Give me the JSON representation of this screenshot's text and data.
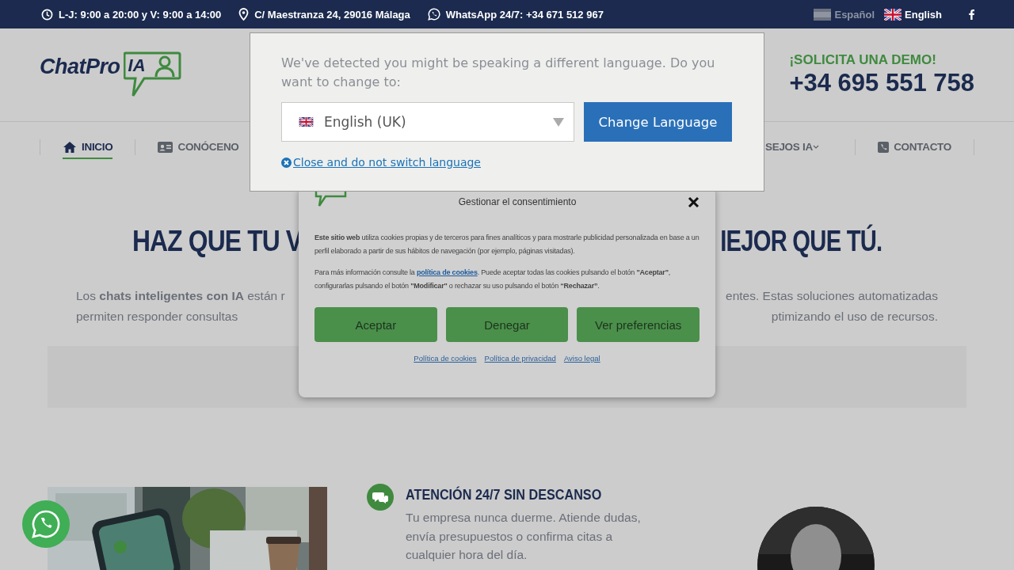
{
  "top_bar": {
    "hours": "L-J: 9:00 a 20:00 y V: 9:00 a 14:00",
    "address": "C/ Maestranza 24, 29016 Málaga",
    "whatsapp": "WhatsApp 24/7: +34 671 512 967",
    "languages": [
      {
        "label": "Español",
        "selected": false
      },
      {
        "label": "English",
        "selected": true
      }
    ]
  },
  "header": {
    "logo_text": "ChatPro",
    "logo_badge": "IA",
    "demo_label": "¡SOLICITA UNA DEMO!",
    "phone": "+34 695 551 758"
  },
  "nav": [
    {
      "label": "INICIO",
      "selected": true,
      "dropdown": false
    },
    {
      "label": "CONÓCENO",
      "selected": false,
      "dropdown": false
    },
    {
      "label": "SEJOS IA",
      "selected": false,
      "dropdown": true
    },
    {
      "label": "CONTACTO",
      "selected": false,
      "dropdown": false
    }
  ],
  "hero": {
    "title_left": "HAZ QUE TU V",
    "title_right": "IEJOR QUE TÚ.",
    "text_left": [
      "Los **chats inteligentes con IA** están r",
      "permiten responder consultas"
    ],
    "text_right": [
      "entes. Estas soluciones automatizadas",
      "ptimizando el uso de recursos."
    ]
  },
  "feature": {
    "title": "ATENCIÓN 24/7 SIN DESCANSO",
    "text": "Tu empresa nunca duerme. Atiende dudas, envía presupuestos o confirma citas a cualquier hora del día."
  },
  "language_popup": {
    "message": "We've detected you might be speaking a different language. Do you want to change to:",
    "select_value": "English (UK)",
    "button": "Change Language",
    "close_link": "Close and do not switch language"
  },
  "cookie_dialog": {
    "title": "Gestionar el consentimiento",
    "paragraph_1": "**Este sitio web** utiliza cookies propias y de terceros para fines analíticos y para mostrarle publicidad personalizada en base a un perfil elaborado a partir de sus hábitos de navegación (por ejemplo, páginas visitadas).",
    "paragraph_2_before": "Para más información consulte la",
    "paragraph_2_link": "política de cookies",
    "paragraph_2_after": ". Puede aceptar todas las cookies pulsando el botón **\"Aceptar\"**, configurarlas pulsando el botón **\"Modificar\"** o rechazar su uso pulsando el botón **“Rechazar”**.",
    "buttons": [
      "Aceptar",
      "Denegar",
      "Ver preferencias"
    ],
    "links": [
      "Política de cookies",
      "Política de privacidad",
      "Aviso legal"
    ]
  }
}
